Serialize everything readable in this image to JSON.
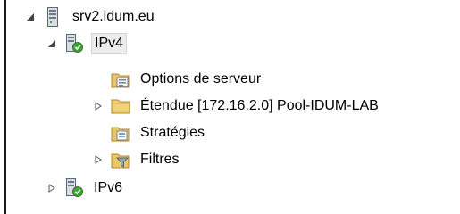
{
  "tree": {
    "server": {
      "label": "srv2.idum.eu",
      "icon": "server-icon",
      "expanded": true
    },
    "ipv4": {
      "label": "IPv4",
      "icon": "ipv4-icon",
      "expanded": true,
      "selected": true
    },
    "ipv4_children": [
      {
        "label": "Options de serveur",
        "icon": "server-options-icon",
        "expandable": false
      },
      {
        "label": "Étendue [172.16.2.0] Pool-IDUM-LAB",
        "icon": "folder-icon",
        "expandable": true
      },
      {
        "label": "Stratégies",
        "icon": "policies-icon",
        "expandable": false
      },
      {
        "label": "Filtres",
        "icon": "filter-icon",
        "expandable": true
      }
    ],
    "ipv6": {
      "label": "IPv6",
      "icon": "ipv6-icon",
      "expanded": false
    }
  }
}
